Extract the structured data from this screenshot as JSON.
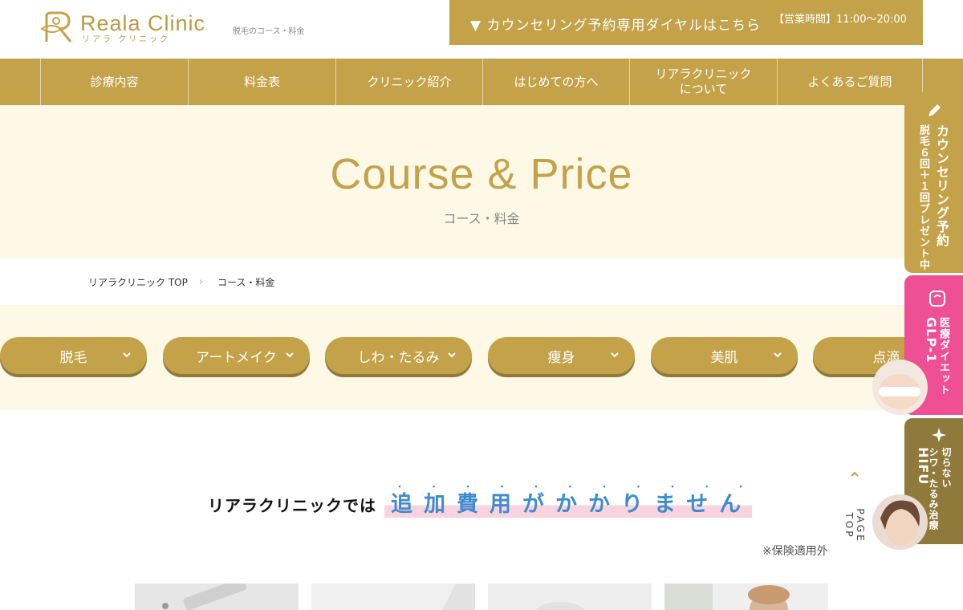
{
  "header": {
    "logo_name": "Reala Clinic",
    "logo_kana": "リアラ クリニック",
    "subtitle": "脱毛のコース・料金",
    "dial_label": "▼ カウンセリング予約専用ダイヤルはこちら",
    "hours": "【営業時間】11:00〜20:00"
  },
  "nav": {
    "items": [
      {
        "label": "診療内容"
      },
      {
        "label": "料金表"
      },
      {
        "label": "クリニック紹介"
      },
      {
        "label": "はじめての方へ"
      },
      {
        "label": "リアラクリニック\nについて"
      },
      {
        "label": "よくあるご質問"
      }
    ]
  },
  "hero": {
    "title_en": "Course & Price",
    "title_ja": "コース・料金"
  },
  "breadcrumb": {
    "home": "リアラクリニック TOP",
    "separator": "›",
    "current": "コース・料金"
  },
  "categories": [
    {
      "label": "脱毛"
    },
    {
      "label": "アートメイク"
    },
    {
      "label": "しわ・たるみ"
    },
    {
      "label": "痩身"
    },
    {
      "label": "美肌"
    },
    {
      "label": "点滴"
    }
  ],
  "main": {
    "tagline_a": "リアラクリニックでは",
    "tagline_b": "追加費用がかかりません",
    "emphasis_dots": "・・・・・・・・・・・",
    "note": "※保険適用外"
  },
  "page_top": "PAGE TOP",
  "side": {
    "counseling_title": "カウンセリング予約",
    "counseling_sub": "脱毛６回＋１回プレゼント中",
    "diet_a": "医療ダイエット",
    "diet_b": "GLP-1",
    "hifu_a": "切らない",
    "hifu_b": "シワ・たるみ治療",
    "hifu_c": "HIFU"
  },
  "colors": {
    "gold": "#c4a24a",
    "gold_dark": "#8f7a3c",
    "cream": "#fdf9e6",
    "pink": "#ee4f95",
    "blue": "#3d8ccf"
  }
}
